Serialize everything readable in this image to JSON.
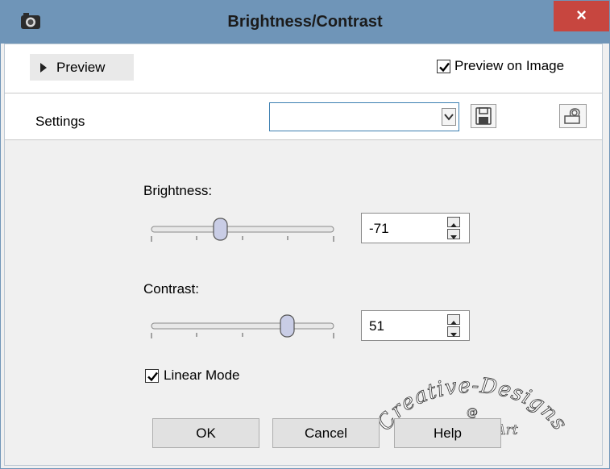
{
  "window": {
    "title": "Brightness/Contrast",
    "close_glyph": "×",
    "app_icon": "camera-icon"
  },
  "preview": {
    "toggle_label": "Preview",
    "preview_on_image_label": "Preview on Image",
    "preview_on_image_checked": true
  },
  "settings": {
    "label": "Settings",
    "preset_value": ""
  },
  "brightness": {
    "label": "Brightness:",
    "value": "-71"
  },
  "contrast": {
    "label": "Contrast:",
    "value": "51"
  },
  "linear_mode": {
    "label": "Linear Mode",
    "checked": true
  },
  "buttons": {
    "ok": "OK",
    "cancel": "Cancel",
    "help": "Help"
  },
  "watermark": {
    "line1": "Creative-Designs",
    "line2": "@",
    "line3": "Ximena Art"
  },
  "colors": {
    "titlebar": "#6f95b8",
    "close": "#c7463f",
    "panel": "#f0f0f0",
    "accent_border": "#3c7fb1"
  }
}
